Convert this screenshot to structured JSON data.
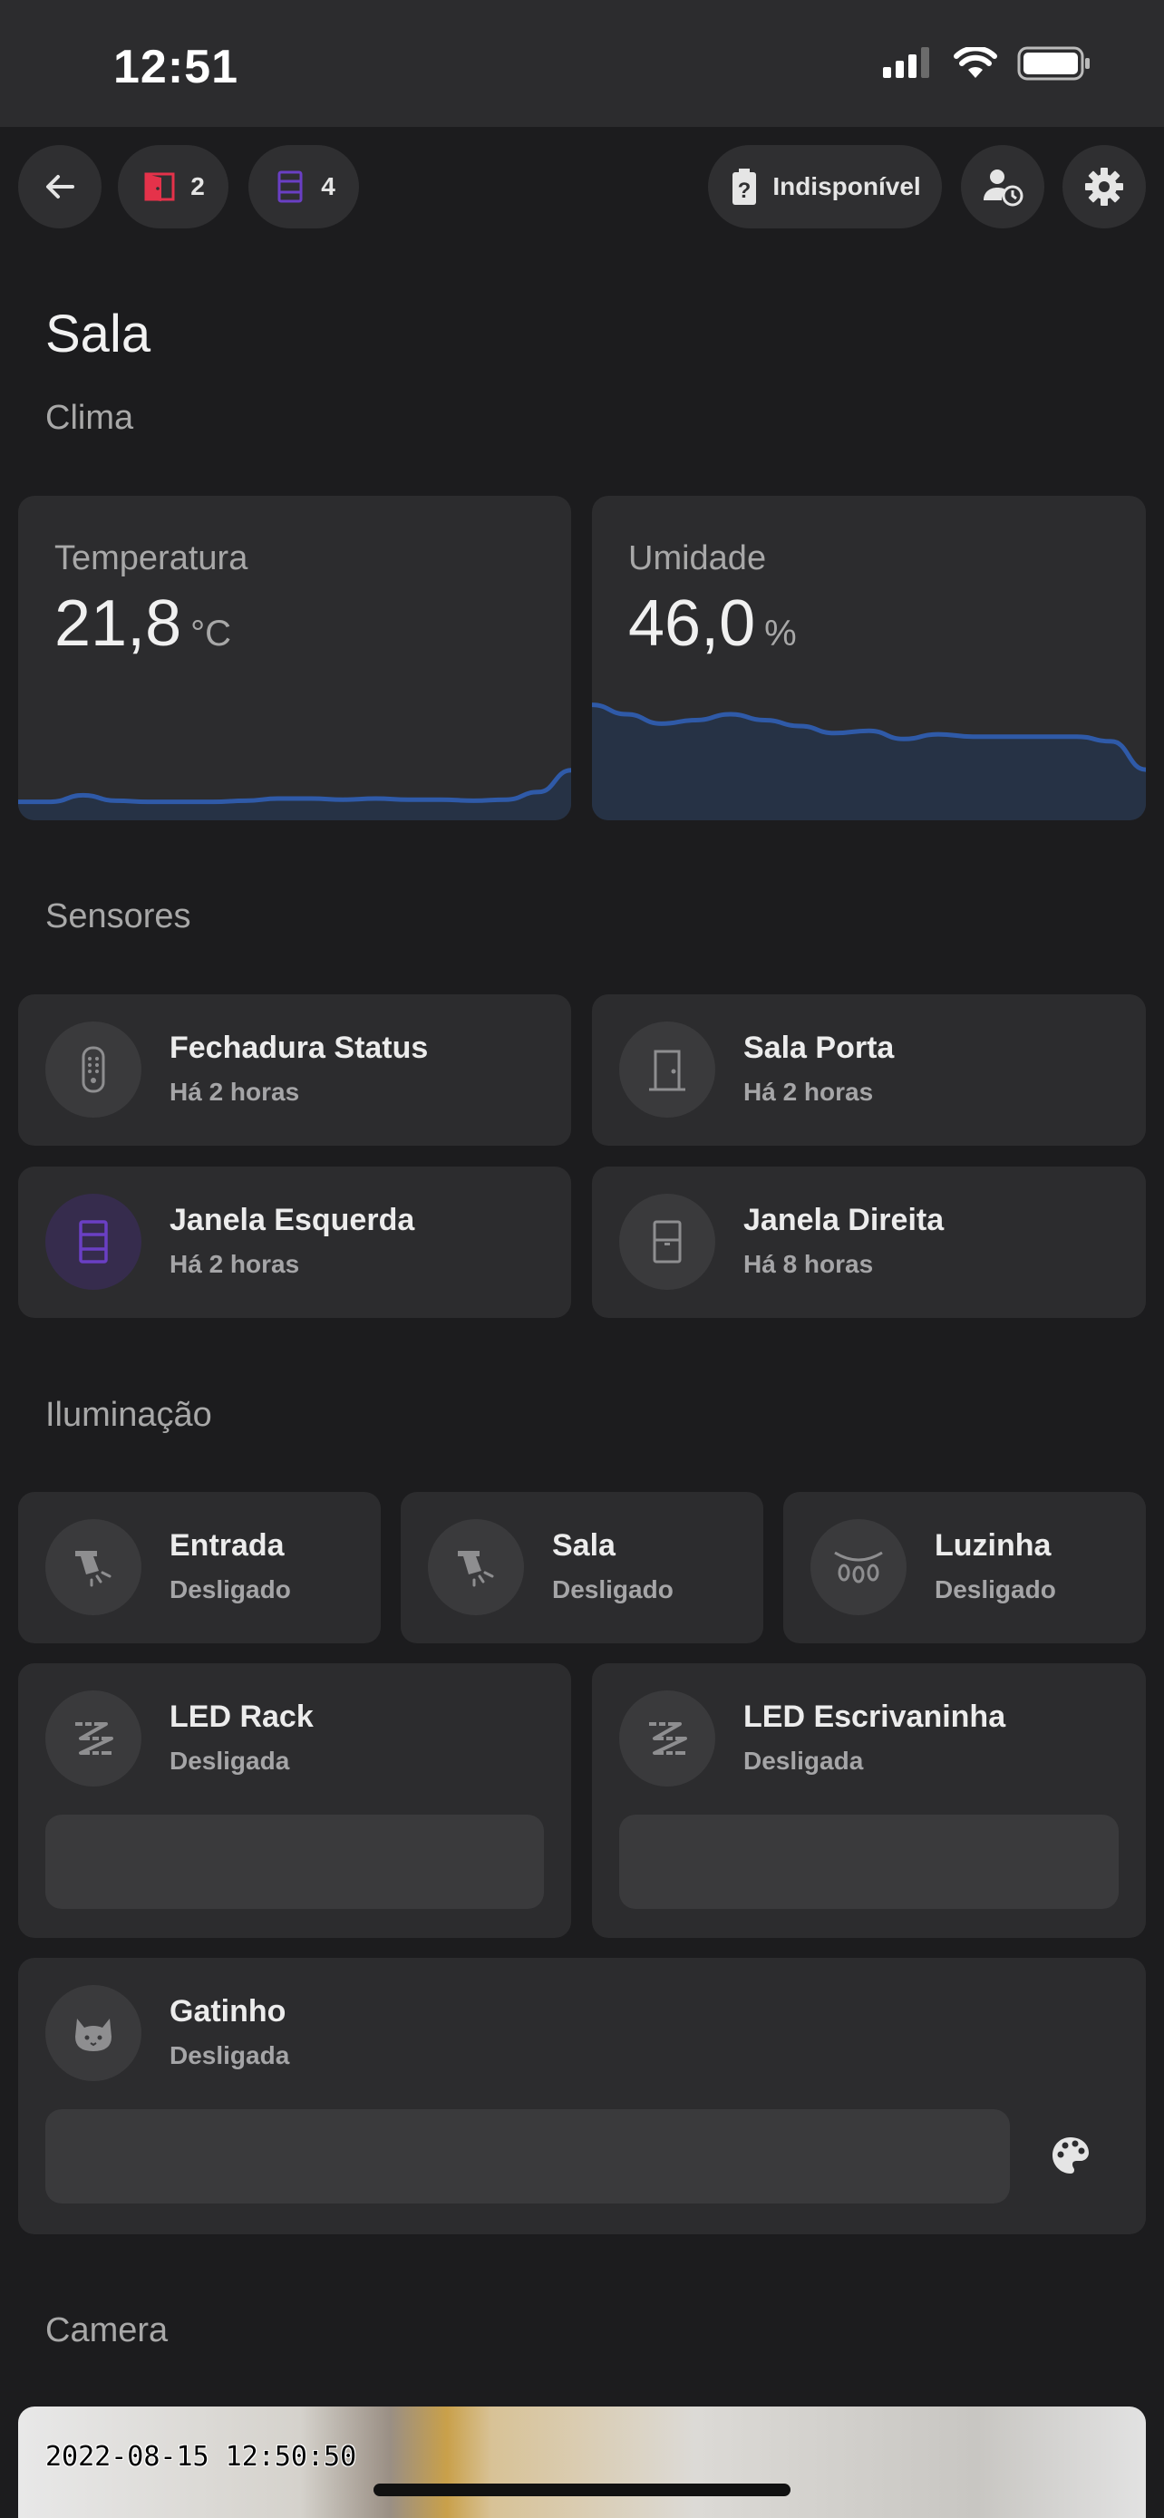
{
  "status_bar": {
    "time": "12:51"
  },
  "nav": {
    "door_count": "2",
    "window_count": "4",
    "battery_label": "Indisponível"
  },
  "page": {
    "title": "Sala"
  },
  "sections": {
    "climate": "Clima",
    "sensors": "Sensores",
    "lighting": "Iluminação",
    "camera": "Camera"
  },
  "climate": {
    "temperature": {
      "label": "Temperatura",
      "value": "21,8",
      "unit": "°C",
      "history": [
        17,
        17,
        23,
        18,
        17,
        17,
        17,
        18,
        20,
        20,
        19,
        20,
        19,
        19,
        18,
        19,
        26,
        46
      ]
    },
    "humidity": {
      "label": "Umidade",
      "value": "46,0",
      "unit": "%",
      "history": [
        98,
        90,
        82,
        85,
        90,
        85,
        80,
        74,
        76,
        69,
        73,
        71,
        71,
        71,
        71,
        67,
        43
      ]
    }
  },
  "sensors": [
    {
      "name": "Fechadura Status",
      "state": "Há 2 horas",
      "icon": "remote-icon"
    },
    {
      "name": "Sala Porta",
      "state": "Há 2 horas",
      "icon": "door-icon"
    },
    {
      "name": "Janela Esquerda",
      "state": "Há 2 horas",
      "icon": "window-open-icon",
      "color": "#6a3fc4"
    },
    {
      "name": "Janela Direita",
      "state": "Há 8 horas",
      "icon": "window-closed-icon"
    }
  ],
  "lights": [
    {
      "name": "Entrada",
      "state": "Desligado",
      "icon": "spotlight-icon"
    },
    {
      "name": "Sala",
      "state": "Desligado",
      "icon": "spotlight-icon"
    },
    {
      "name": "Luzinha",
      "state": "Desligado",
      "icon": "string-lights-icon"
    },
    {
      "name": "LED Rack",
      "state": "Desligada",
      "icon": "led-strip-icon"
    },
    {
      "name": "LED Escrivaninha",
      "state": "Desligada",
      "icon": "led-strip-icon"
    },
    {
      "name": "Gatinho",
      "state": "Desligada",
      "icon": "cat-icon"
    }
  ],
  "camera": {
    "timestamp": "2022-08-15 12:50:50"
  },
  "colors": {
    "accent_door": "#e5324a",
    "accent_window": "#6a3fc4",
    "chart_line": "#2f5aa8",
    "chart_fill": "#263245"
  }
}
